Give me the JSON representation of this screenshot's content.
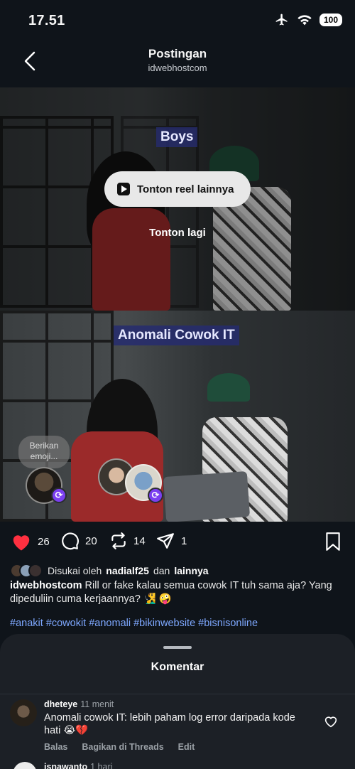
{
  "status": {
    "time": "17.51",
    "battery": "100"
  },
  "header": {
    "title": "Postingan",
    "subtitle": "idwebhostcom"
  },
  "media": {
    "caption_top": "Boys",
    "caption_bottom": "Anomali Cowok IT",
    "reel_button": "Tonton reel lainnya",
    "watch_again": "Tonton lagi",
    "emoji_prompt": "Berikan emoji..."
  },
  "actions": {
    "likes": "26",
    "comments": "20",
    "reposts": "14",
    "shares": "1"
  },
  "liked_by": {
    "prefix": "Disukai oleh",
    "user": "nadialf25",
    "conj": "dan",
    "others": "lainnya"
  },
  "post": {
    "author": "idwebhostcom",
    "caption": "Rill or fake kalau semua cowok IT tuh sama aja? Yang dipeduliin cuma kerjaannya? 🧏‍♂️ 🤪",
    "hashtags": "#anakit #cowokit #anomali #bikinwebsite #bisnisonline"
  },
  "comments_sheet": {
    "title": "Komentar",
    "comments": [
      {
        "user": "dheteye",
        "time": "11 menit",
        "text": "Anomali cowok IT: lebih paham log error daripada kode hati 😭💔",
        "reply": "Balas",
        "share": "Bagikan di Threads",
        "edit": "Edit"
      },
      {
        "user": "isnawanto",
        "time": "1 hari"
      }
    ]
  },
  "colors": {
    "like": "#ff3040",
    "repost_badge": "#7b3ff0",
    "hashtag": "#7ea8ff"
  }
}
